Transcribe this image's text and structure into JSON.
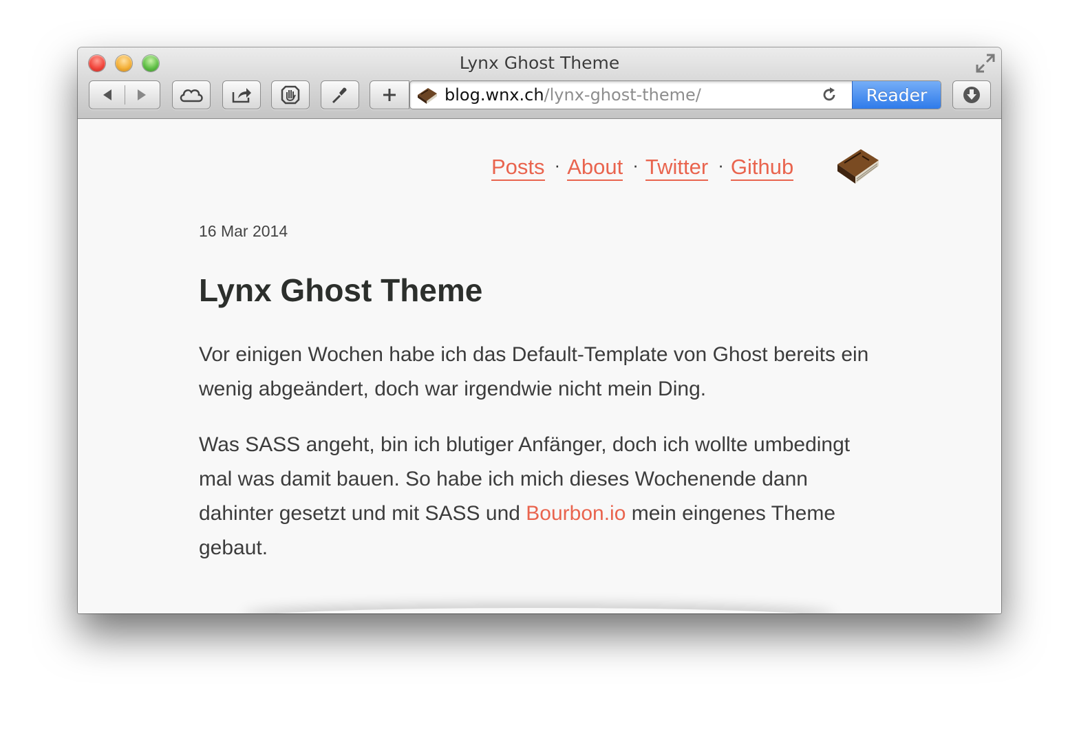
{
  "window": {
    "title": "Lynx Ghost Theme"
  },
  "toolbar": {
    "address_domain": "blog.wnx.ch",
    "address_path": "/lynx-ghost-theme/",
    "reader_label": "Reader",
    "icons": [
      "back-icon",
      "forward-icon",
      "icloud-icon",
      "share-icon",
      "adblock-icon",
      "tools-icon",
      "new-tab-icon",
      "site-favicon",
      "reload-icon",
      "downloads-icon",
      "fullscreen-icon"
    ]
  },
  "site": {
    "nav": [
      {
        "label": "Posts"
      },
      {
        "label": "About"
      },
      {
        "label": "Twitter"
      },
      {
        "label": "Github"
      }
    ],
    "accent_color": "#e9644e"
  },
  "post": {
    "date": "16 Mar 2014",
    "title": "Lynx Ghost Theme",
    "paragraph1": "Vor einigen Wochen habe ich das Default-Template von Ghost bereits ein wenig abgeändert, doch war irgendwie nicht mein Ding.",
    "paragraph2_before": "Was SASS angeht, bin ich blutiger Anfänger, doch ich wollte umbedingt mal was damit bauen. So habe ich mich dieses Wochenende dann dahinter gesetzt und mit SASS und ",
    "paragraph2_link": "Bourbon.io",
    "paragraph2_after": " mein eingenes Theme gebaut."
  }
}
